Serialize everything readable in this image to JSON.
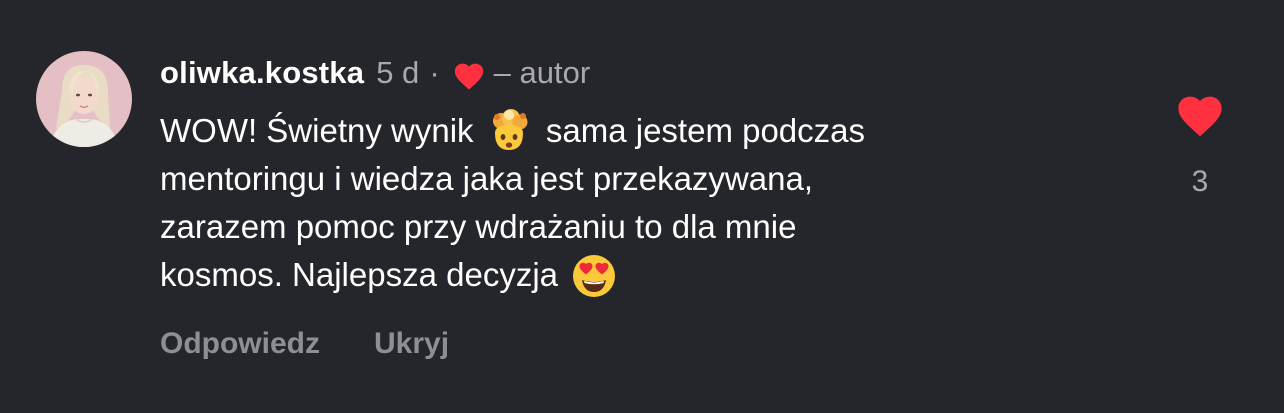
{
  "comment": {
    "username": "oliwka.kostka",
    "age": "5 d",
    "separator": "·",
    "author_label": "– autor",
    "text_lines": [
      {
        "before": "WOW! Świetny wynik ",
        "emoji": "exploding-head-emoji",
        "after": " sama jestem podczas"
      },
      {
        "text": "mentoringu i wiedza jaka jest przekazywana,"
      },
      {
        "text": "zarazem pomoc przy wdrażaniu to dla mnie"
      },
      {
        "before": "kosmos. Najlepsza decyzja ",
        "emoji": "heart-eyes-emoji"
      }
    ],
    "actions": {
      "reply_label": "Odpowiedz",
      "hide_label": "Ukryj"
    },
    "likes": {
      "count": "3",
      "liked": true,
      "heart_color": "#ff3040"
    }
  },
  "colors": {
    "background": "#25262b",
    "primary_text": "#ffffff",
    "secondary_text": "#a8a8ad",
    "action_text": "#8e8f94",
    "heart": "#ff3040"
  }
}
